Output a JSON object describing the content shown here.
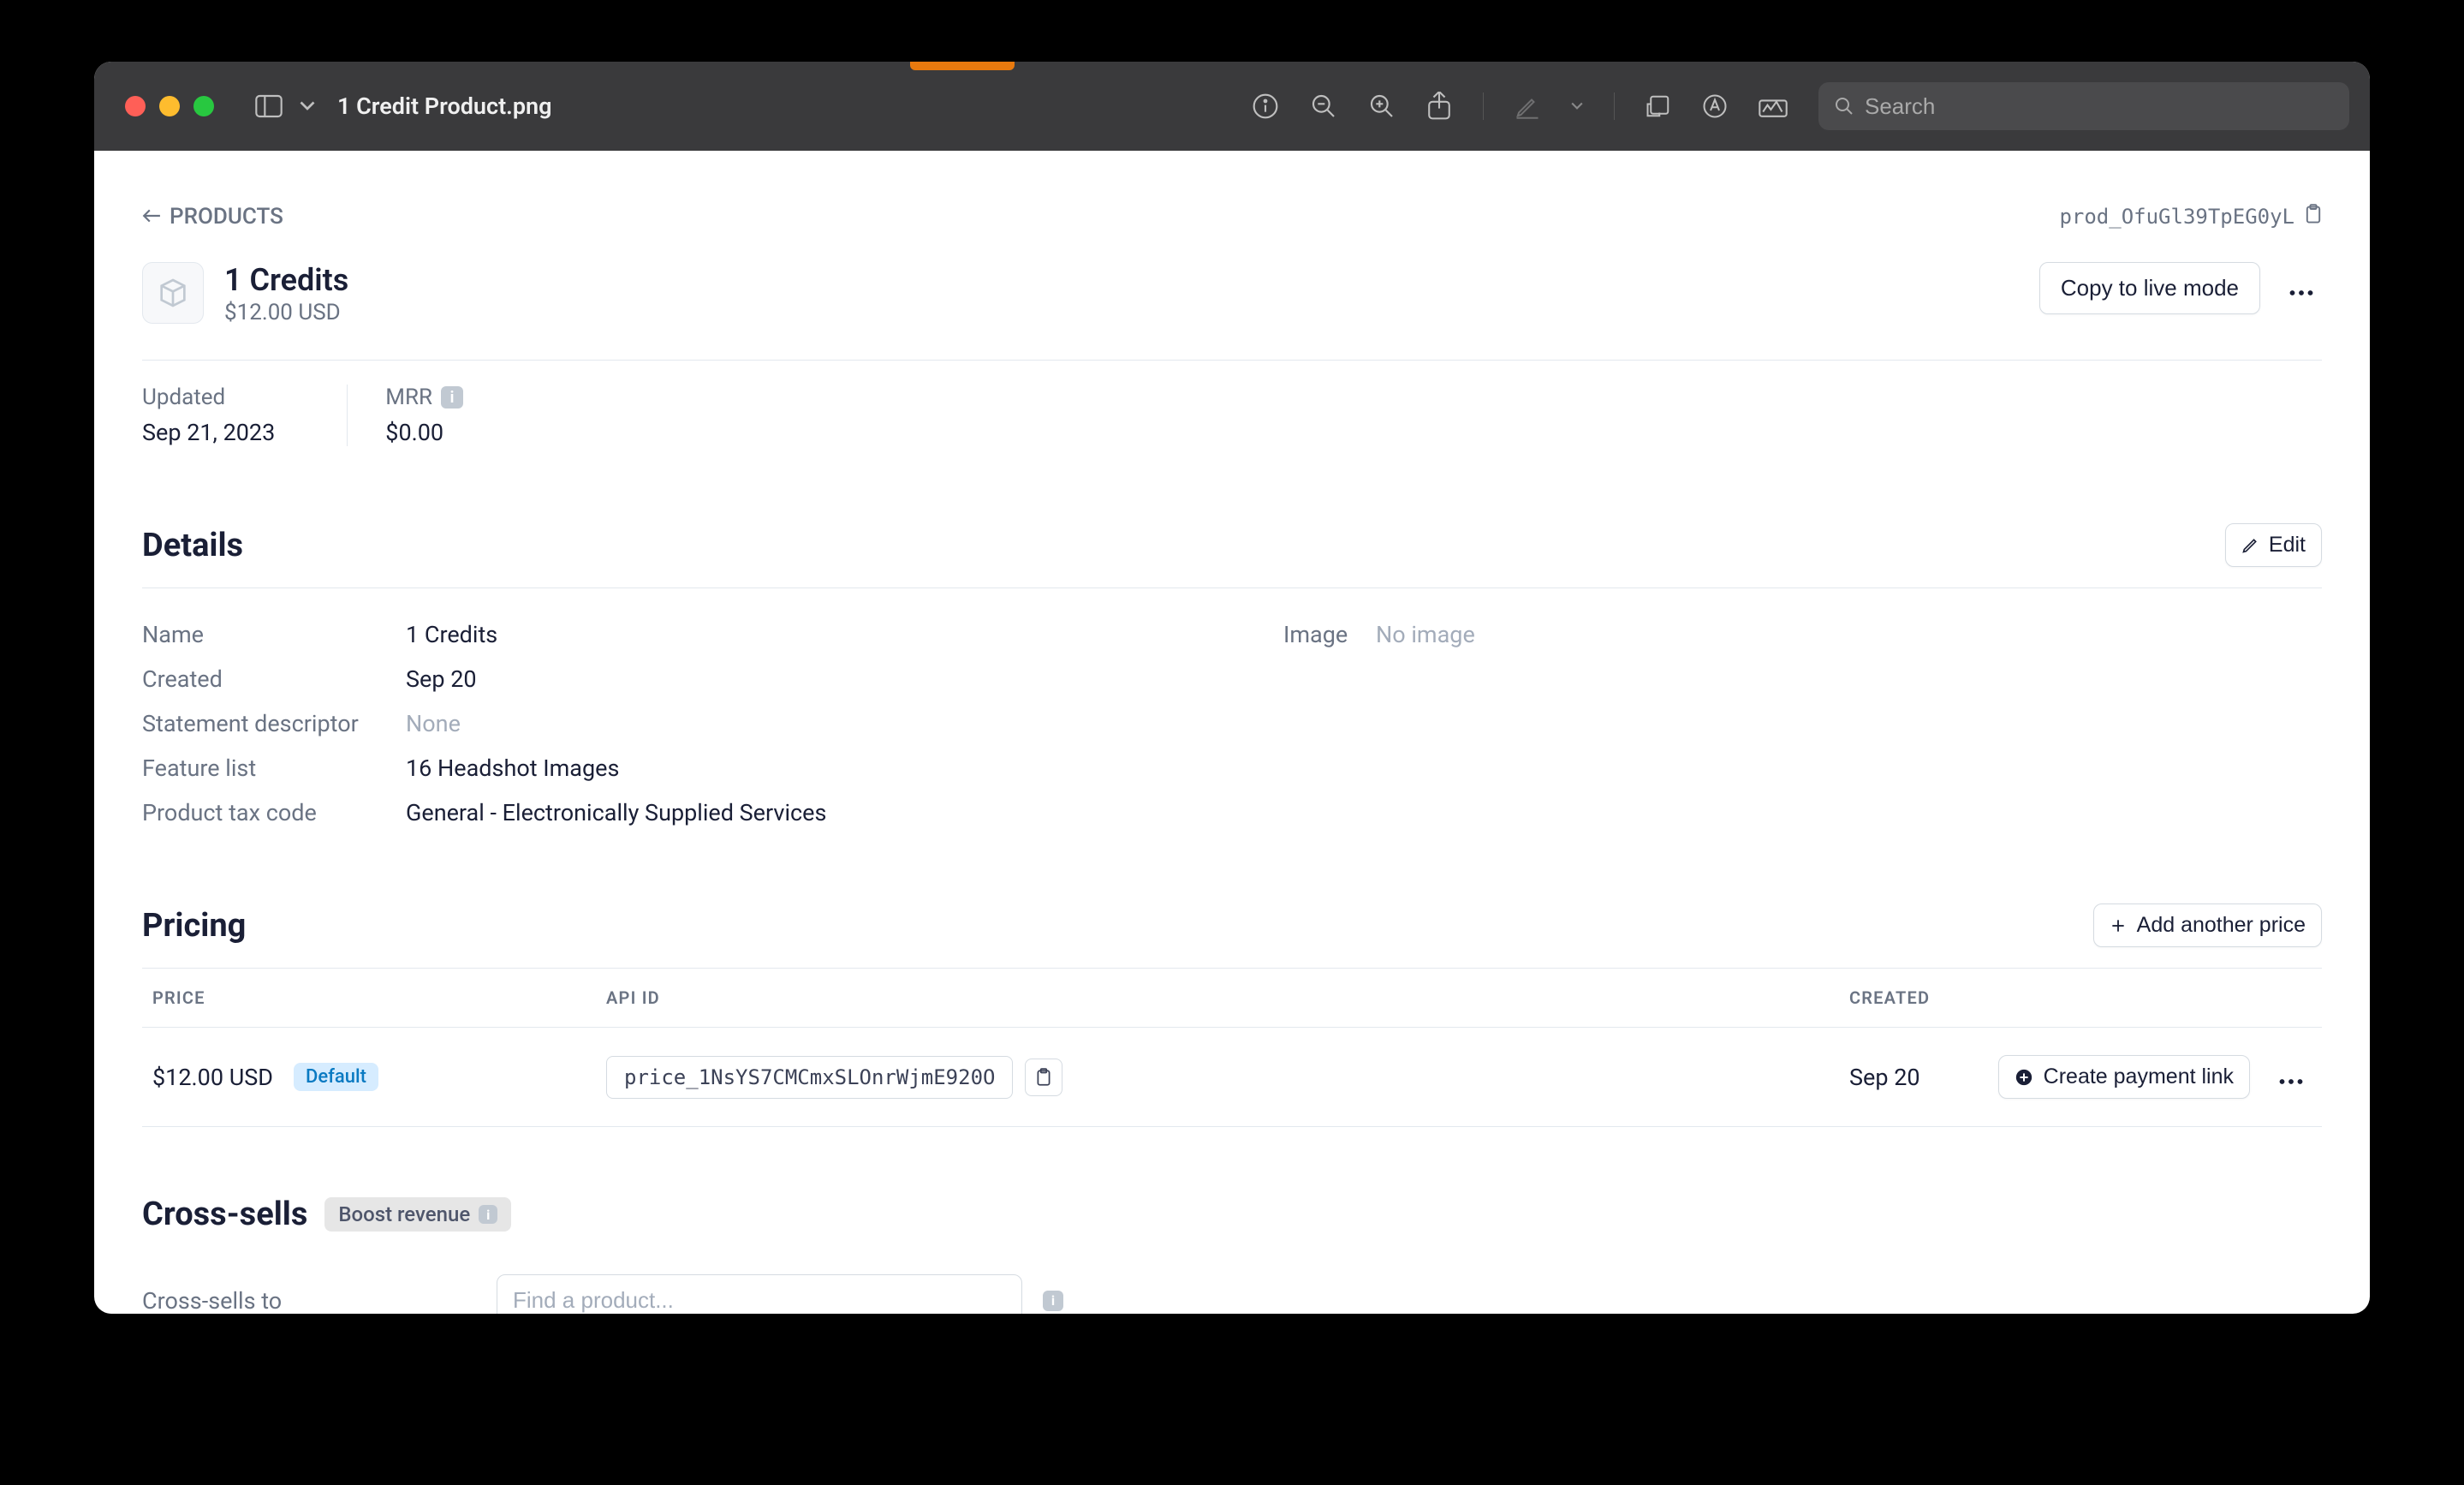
{
  "window": {
    "title": "1 Credit Product.png",
    "search_placeholder": "Search"
  },
  "breadcrumb": {
    "label": "PRODUCTS"
  },
  "product": {
    "id": "prod_OfuGl39TpEG0yL",
    "title": "1 Credits",
    "price_display": "$12.00 USD"
  },
  "actions": {
    "copy_live": "Copy to live mode",
    "edit": "Edit",
    "add_price": "Add another price",
    "create_link": "Create payment link"
  },
  "stats": {
    "updated_label": "Updated",
    "updated_value": "Sep 21, 2023",
    "mrr_label": "MRR",
    "mrr_value": "$0.00"
  },
  "sections": {
    "details": "Details",
    "pricing": "Pricing",
    "cross_sells": "Cross-sells"
  },
  "details": {
    "name_label": "Name",
    "name_value": "1 Credits",
    "created_label": "Created",
    "created_value": "Sep 20",
    "stmt_label": "Statement descriptor",
    "stmt_value": "None",
    "feat_label": "Feature list",
    "feat_value": "16 Headshot Images",
    "tax_label": "Product tax code",
    "tax_value": "General - Electronically Supplied Services",
    "image_label": "Image",
    "image_value": "No image"
  },
  "pricing": {
    "head_price": "PRICE",
    "head_api": "API ID",
    "head_created": "CREATED",
    "row_price": "$12.00 USD",
    "row_default": "Default",
    "row_api_id": "price_1NsYS7CMCmxSLOnrWjmE920O",
    "row_created": "Sep 20"
  },
  "cross": {
    "boost": "Boost revenue",
    "to_label": "Cross-sells to",
    "placeholder": "Find a product..."
  }
}
